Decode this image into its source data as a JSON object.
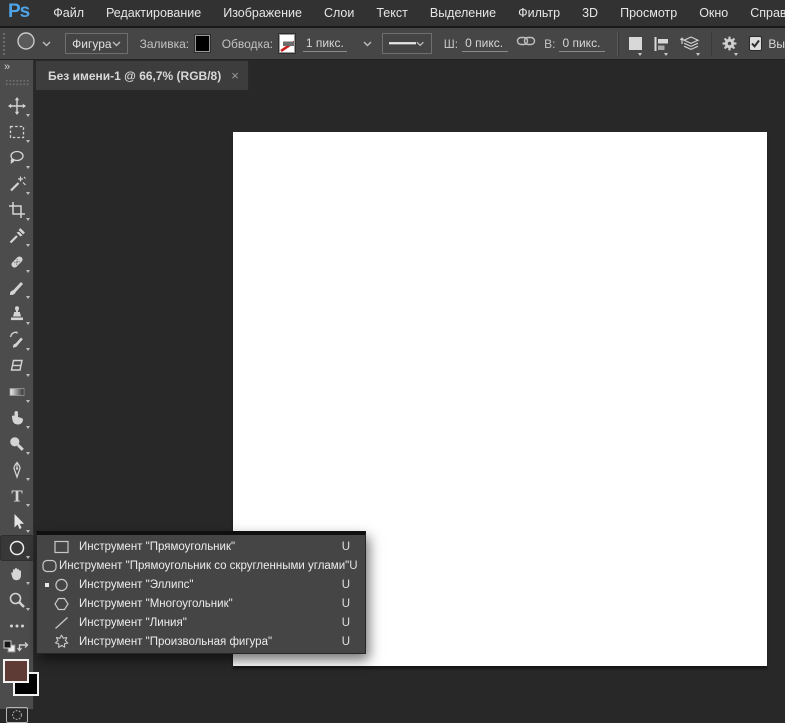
{
  "app": {
    "logo": "Ps"
  },
  "menu": {
    "items": [
      "Файл",
      "Редактирование",
      "Изображение",
      "Слои",
      "Текст",
      "Выделение",
      "Фильтр",
      "3D",
      "Просмотр",
      "Окно",
      "Справка"
    ]
  },
  "options": {
    "mode_value": "Фигура",
    "fill_label": "Заливка:",
    "fill_color": "#000000",
    "stroke_label": "Обводка:",
    "stroke_color": "none",
    "stroke_size": "1 пикс.",
    "w_label": "Ш:",
    "w_value": "0 пикс.",
    "h_label": "В:",
    "h_value": "0 пикс.",
    "align_edges_label": "Вы",
    "align_edges_checked": true
  },
  "tab": {
    "title": "Без имени-1 @ 66,7% (RGB/8)",
    "close": "×"
  },
  "toolbar": {
    "collapse": "»",
    "tools": [
      "move-tool",
      "rectangular-marquee-tool",
      "lasso-tool",
      "quick-selection-tool",
      "crop-tool",
      "eyedropper-tool",
      "spot-healing-brush-tool",
      "brush-tool",
      "clone-stamp-tool",
      "history-brush-tool",
      "eraser-tool",
      "gradient-tool",
      "smudge-tool",
      "dodge-tool",
      "pen-tool",
      "type-tool",
      "path-selection-tool",
      "ellipse-tool",
      "hand-tool",
      "zoom-tool",
      "edit-toolbar-ellipsis"
    ],
    "selected_tool": "ellipse-tool"
  },
  "colors": {
    "foreground": "#5e3b34",
    "background": "#000000",
    "logo_blue": "#4ea3e6"
  },
  "shape_menu": {
    "items": [
      {
        "icon": "rectangle-tool-icon",
        "label": "Инструмент \"Прямоугольник\"",
        "shortcut": "U",
        "active": false
      },
      {
        "icon": "rounded-rectangle-tool-icon",
        "label": "Инструмент \"Прямоугольник со скругленными углами\"",
        "shortcut": "U",
        "active": false
      },
      {
        "icon": "ellipse-tool-icon",
        "label": "Инструмент \"Эллипс\"",
        "shortcut": "U",
        "active": true
      },
      {
        "icon": "polygon-tool-icon",
        "label": "Инструмент \"Многоугольник\"",
        "shortcut": "U",
        "active": false
      },
      {
        "icon": "line-tool-icon",
        "label": "Инструмент \"Линия\"",
        "shortcut": "U",
        "active": false
      },
      {
        "icon": "custom-shape-tool-icon",
        "label": "Инструмент \"Произвольная фигура\"",
        "shortcut": "U",
        "active": false
      }
    ]
  }
}
